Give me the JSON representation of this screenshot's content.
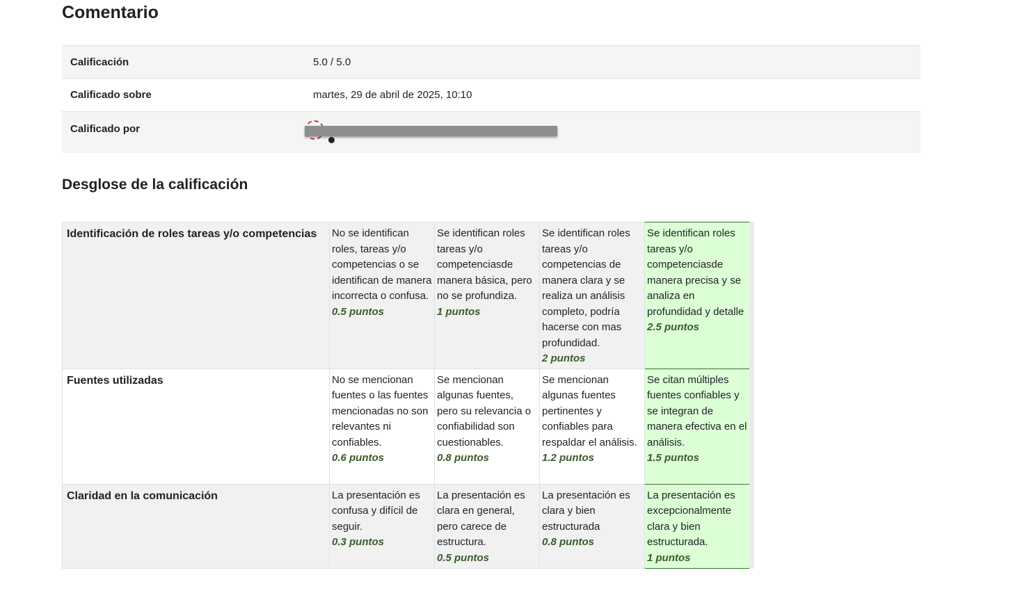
{
  "page": {
    "title": "Comentario"
  },
  "grade_info": {
    "rows": [
      {
        "label": "Calificación",
        "value": "5.0 / 5.0"
      },
      {
        "label": "Calificado sobre",
        "value": "martes, 29 de abril de 2025, 10:10"
      },
      {
        "label": "Calificado por",
        "value": ""
      }
    ]
  },
  "breakdown": {
    "title": "Desglose de la calificación",
    "criteria": [
      {
        "name": "Identificación de roles tareas y/o competencias",
        "levels": [
          {
            "text": "No se identifican roles, tareas y/o competencias o se identifican de manera incorrecta o confusa.",
            "points": "0.5 puntos"
          },
          {
            "text": "Se identifican roles tareas y/o competenciasde manera básica, pero no se profundiza.",
            "points": "1 puntos"
          },
          {
            "text": "Se identifican roles tareas y/o competencias de manera clara y se realiza un análisis completo, podría hacerse con mas profundidad.",
            "points": "2 puntos"
          },
          {
            "text": "Se identifican roles tareas y/o competenciasde manera precisa y se analiza en profundidad y detalle",
            "points": "2.5 puntos"
          }
        ]
      },
      {
        "name": "Fuentes utilizadas",
        "levels": [
          {
            "text": "No se mencionan fuentes o las fuentes mencionadas no son relevantes ni confiables.",
            "points": "0.6 puntos"
          },
          {
            "text": "Se mencionan algunas fuentes, pero su relevancia o confiabilidad son cuestionables.",
            "points": "0.8 puntos"
          },
          {
            "text": "Se mencionan algunas fuentes pertinentes y confiables para respaldar el análisis.",
            "points": "1.2 puntos"
          },
          {
            "text": "Se citan múltiples fuentes confiables y se integran de manera efectiva en el análisis.",
            "points": "1.5 puntos"
          }
        ]
      },
      {
        "name": "Claridad en la comunicación",
        "levels": [
          {
            "text": "La presentación es confusa y difícil de seguir.",
            "points": "0.3 puntos"
          },
          {
            "text": "La presentación es clara en general, pero carece de estructura.",
            "points": "0.5 puntos"
          },
          {
            "text": "La presentación es clara y bien estructurada",
            "points": "0.8 puntos"
          },
          {
            "text": "La presentación es excepcionalmente clara y bien estructurada.",
            "points": "1 puntos"
          }
        ]
      }
    ]
  }
}
